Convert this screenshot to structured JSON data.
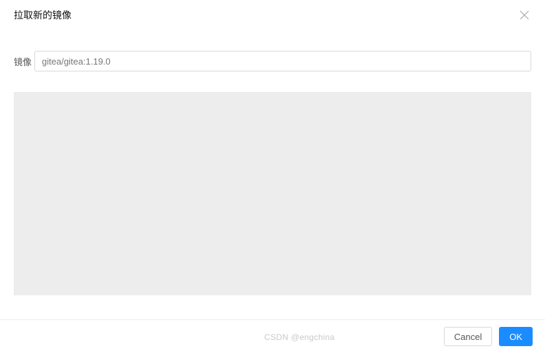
{
  "modal": {
    "title": "拉取新的镜像"
  },
  "field": {
    "label": "镜像",
    "value": "gitea/gitea:1.19.0"
  },
  "footer": {
    "cancel_label": "Cancel",
    "ok_label": "OK"
  },
  "watermark": "CSDN @engchina"
}
